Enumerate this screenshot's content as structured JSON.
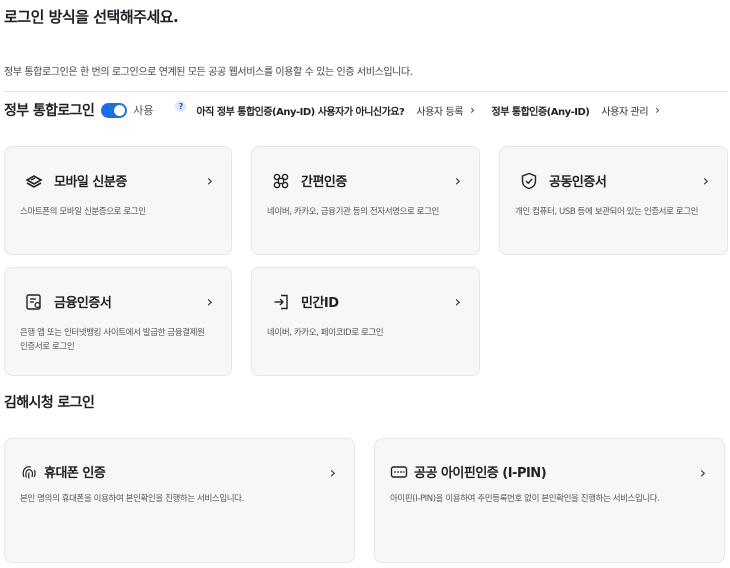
{
  "page": {
    "title": "로그인 방식을 선택해주세요.",
    "description": "정부 통합로그인은 한 번의 로그인으로 연계된 모든 공공 웹서비스를 이용할 수 있는 인증 서비스입니다."
  },
  "gov_bar": {
    "label": "정부 통합로그인",
    "toggle_state": "on",
    "toggle_text": "사용",
    "help_glyph": "?",
    "question": "아직 정부 통합인증(Any-ID) 사용자가 아니신가요?",
    "register_link": "사용자 등록",
    "anyid_label": "정부 통합인증(Any-ID)",
    "manage_link": "사용자 관리",
    "chevron": "›"
  },
  "methods": [
    {
      "icon": "mobile-id-icon",
      "title": "모바일 신분증",
      "desc": "스마트폰의 모바일 신분증으로 로그인"
    },
    {
      "icon": "simple-auth-icon",
      "title": "간편인증",
      "desc": "네이버, 카카오, 금융기관 등의 전자서명으로 로그인"
    },
    {
      "icon": "shield-check-icon",
      "title": "공동인증서",
      "desc": "개인 컴퓨터, USB 등에 보관되어 있는 인증서로 로그인"
    },
    {
      "icon": "certificate-icon",
      "title": "금융인증서",
      "desc": "은행 앱 또는 인터넷뱅킹 사이트에서 발급한 금융결제원 인증서로 로그인"
    },
    {
      "icon": "login-arrow-icon",
      "title": "민간ID",
      "desc": "네이버, 카카오, 페이코ID로 로그인"
    }
  ],
  "section2": {
    "title": "김해시청 로그인",
    "cards": [
      {
        "icon": "fingerprint-icon",
        "title": "휴대폰 인증",
        "desc": "본인 명의의 휴대폰을 이용하여 본인확인을 진행하는 서비스입니다."
      },
      {
        "icon": "ipin-card-icon",
        "title": "공공 아이핀인증 (I-PIN)",
        "desc": "아이핀(I-PIN)을 이용하여 주민등록번호 없이 본인확인을 진행하는 서비스입니다."
      }
    ]
  },
  "colors": {
    "accent": "#1e6de8",
    "card_bg": "#f7f7f7",
    "card_border": "#e6e6e6",
    "text": "#1e2124"
  },
  "chevron": "›"
}
